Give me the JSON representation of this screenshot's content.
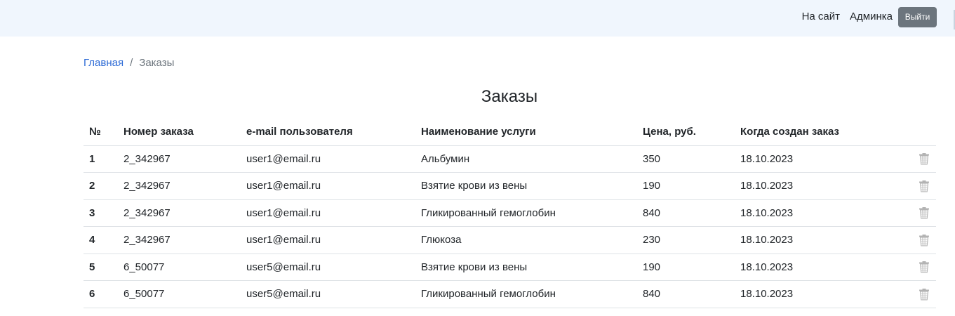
{
  "header": {
    "site_link": "На сайт",
    "admin_link": "Админка",
    "logout_label": "Выйти"
  },
  "breadcrumb": {
    "home": "Главная",
    "separator": "/",
    "current": "Заказы"
  },
  "page_title": "Заказы",
  "table": {
    "headers": [
      "№",
      "Номер заказа",
      "e-mail пользователя",
      "Наименование услуги",
      "Цена, руб.",
      "Когда создан заказ",
      ""
    ],
    "rows": [
      {
        "n": "1",
        "order": "2_342967",
        "email": "user1@email.ru",
        "service": "Альбумин",
        "price": "350",
        "date": "18.10.2023"
      },
      {
        "n": "2",
        "order": "2_342967",
        "email": "user1@email.ru",
        "service": "Взятие крови из вены",
        "price": "190",
        "date": "18.10.2023"
      },
      {
        "n": "3",
        "order": "2_342967",
        "email": "user1@email.ru",
        "service": "Гликированный гемоглобин",
        "price": "840",
        "date": "18.10.2023"
      },
      {
        "n": "4",
        "order": "2_342967",
        "email": "user1@email.ru",
        "service": "Глюкоза",
        "price": "230",
        "date": "18.10.2023"
      },
      {
        "n": "5",
        "order": "6_50077",
        "email": "user5@email.ru",
        "service": "Взятие крови из вены",
        "price": "190",
        "date": "18.10.2023"
      },
      {
        "n": "6",
        "order": "6_50077",
        "email": "user5@email.ru",
        "service": "Гликированный гемоглобин",
        "price": "840",
        "date": "18.10.2023"
      }
    ],
    "row_action_icon": "trash-icon"
  },
  "colors": {
    "navbar_bg": "#f0f6fd",
    "link": "#2e6bd6",
    "button_secondary": "#6c757d",
    "border": "#dee2e6"
  }
}
